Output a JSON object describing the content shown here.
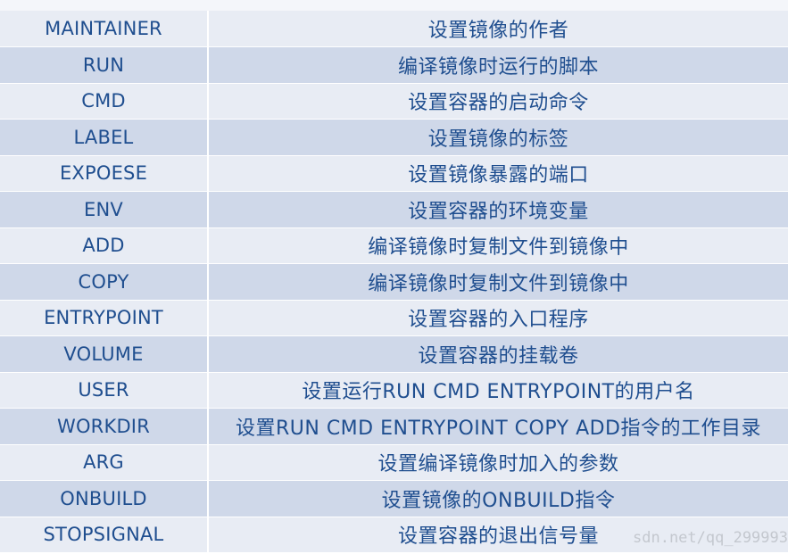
{
  "table": {
    "rows": [
      {
        "instruction": "MAINTAINER",
        "description": "设置镜像的作者"
      },
      {
        "instruction": "RUN",
        "description": "编译镜像时运行的脚本"
      },
      {
        "instruction": "CMD",
        "description": "设置容器的启动命令"
      },
      {
        "instruction": "LABEL",
        "description": "设置镜像的标签"
      },
      {
        "instruction": "EXPOESE",
        "description": "设置镜像暴露的端口"
      },
      {
        "instruction": "ENV",
        "description": "设置容器的环境变量"
      },
      {
        "instruction": "ADD",
        "description": "编译镜像时复制文件到镜像中"
      },
      {
        "instruction": "COPY",
        "description": "编译镜像时复制文件到镜像中"
      },
      {
        "instruction": "ENTRYPOINT",
        "description": "设置容器的入口程序"
      },
      {
        "instruction": "VOLUME",
        "description": "设置容器的挂载卷"
      },
      {
        "instruction": "USER",
        "description": "设置运行RUN CMD ENTRYPOINT的用户名"
      },
      {
        "instruction": "WORKDIR",
        "description": "设置RUN CMD ENTRYPOINT COPY ADD指令的工作目录"
      },
      {
        "instruction": "ARG",
        "description": "设置编译镜像时加入的参数"
      },
      {
        "instruction": "ONBUILD",
        "description": "设置镜像的ONBUILD指令"
      },
      {
        "instruction": "STOPSIGNAL",
        "description": "设置容器的退出信号量"
      }
    ]
  },
  "watermark": "sdn.net/qq_299993",
  "colors": {
    "text": "#1f4e8f",
    "row_light": "#e8ecf4",
    "row_dark": "#cfd8e9"
  }
}
